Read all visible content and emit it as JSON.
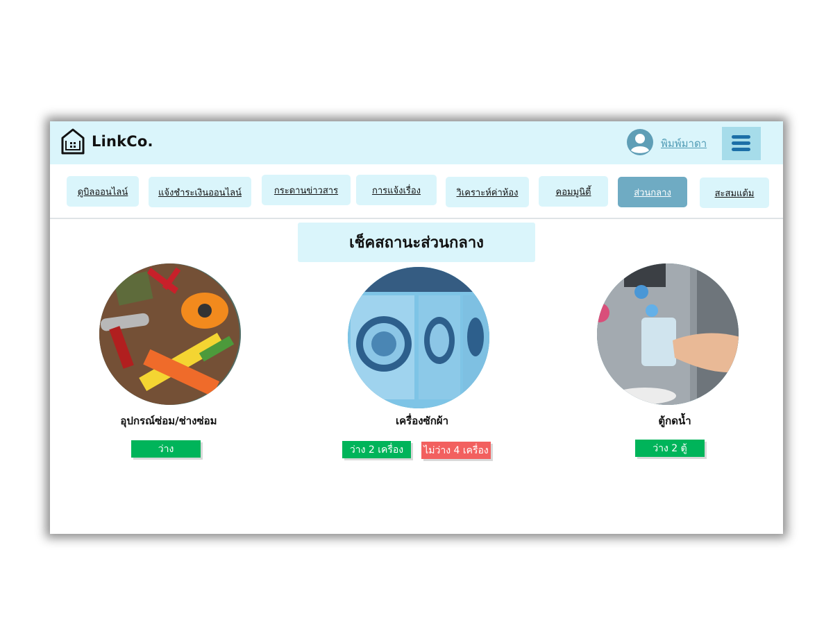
{
  "header": {
    "brand": "LinkCo.",
    "username": "พิมพ์มาดา"
  },
  "nav": {
    "tabs": [
      {
        "label": "ดูบิลออนไลน์"
      },
      {
        "label": "แจ้งชำระเงินออนไลน์"
      },
      {
        "label": "กระดานข่าวสาร"
      },
      {
        "label": "การแจ้งเรื่อง"
      },
      {
        "label": "วิเคราะห์ค่าห้อง"
      },
      {
        "label": "คอมมูนิตี้"
      },
      {
        "label": "ส่วนกลาง",
        "active": true
      },
      {
        "label": "สะสมแต้ม"
      }
    ]
  },
  "page": {
    "title": "เช็คสถานะส่วนกลาง"
  },
  "facilities": [
    {
      "name": "อุปกรณ์ซ่อม/ช่างซ่อม",
      "image": "tools-photo",
      "statuses": [
        {
          "text": "ว่าง",
          "color": "#00b45a"
        }
      ]
    },
    {
      "name": "เครื่องซักผ้า",
      "image": "washing-machines-photo",
      "statuses": [
        {
          "text": "ว่าง 2 เครื่อง",
          "color": "#00b45a"
        },
        {
          "text": "ไม่ว่าง 4 เครื่อง",
          "color": "#f2605f"
        }
      ]
    },
    {
      "name": "ตู้กดน้ำ",
      "image": "water-dispenser-photo",
      "statuses": [
        {
          "text": "ว่าง 2 ตู้",
          "color": "#00b45a"
        }
      ]
    }
  ],
  "colors": {
    "header_bg": "#daf5fb",
    "active_tab": "#6fabc3",
    "accent": "#1c6fa7",
    "available": "#00b45a",
    "unavailable": "#f2605f"
  }
}
